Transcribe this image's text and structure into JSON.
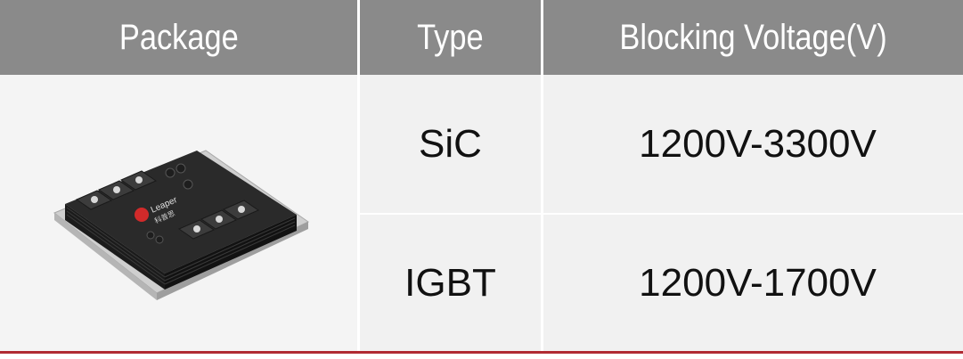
{
  "headers": {
    "package": "Package",
    "type": "Type",
    "voltage": "Blocking Voltage(V)"
  },
  "rows": [
    {
      "type": "SiC",
      "voltage": "1200V-3300V"
    },
    {
      "type": "IGBT",
      "voltage": "1200V-1700V"
    }
  ],
  "module_image": {
    "brand_text": "Leaper",
    "brand_text_cn": "科普思"
  },
  "colors": {
    "header_bg": "#8a8a8a",
    "cell_bg": "#f1f1f1",
    "accent_line": "#b02a32"
  }
}
